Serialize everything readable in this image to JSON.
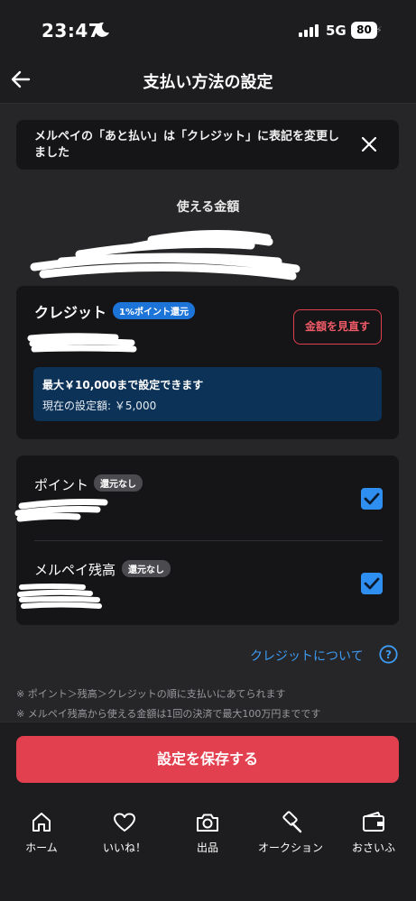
{
  "status": {
    "time": "23:47",
    "network": "5G",
    "battery": "80"
  },
  "header": {
    "title": "支払い方法の設定"
  },
  "notice": {
    "text": "メルペイの「あと払い」は「クレジット」に表記を変更しました"
  },
  "available": {
    "title": "使える金額"
  },
  "credit": {
    "label": "クレジット",
    "badge": "1%ポイント還元",
    "adjust_button": "金額を見直す",
    "limit_max": "最大￥10,000まで設定できます",
    "limit_current": "現在の設定額: ￥5,000"
  },
  "sources": [
    {
      "label": "ポイント",
      "badge": "還元なし",
      "checked": true
    },
    {
      "label": "メルペイ残高",
      "badge": "還元なし",
      "checked": true
    }
  ],
  "credit_about": "クレジットについて",
  "notes": [
    "※ ポイント＞残高＞クレジットの順に支払いにあてられます",
    "※ メルペイ残高から使える金額は1回の決済で最大100万円までです"
  ],
  "save_button": "設定を保存する",
  "nav": [
    {
      "label": "ホーム",
      "icon": "home-icon"
    },
    {
      "label": "いいね！",
      "icon": "heart-icon"
    },
    {
      "label": "出品",
      "icon": "camera-icon"
    },
    {
      "label": "オークション",
      "icon": "gavel-icon"
    },
    {
      "label": "おさいふ",
      "icon": "wallet-icon"
    }
  ],
  "colors": {
    "accent_red": "#e2404f",
    "link_blue": "#3d9bf2",
    "check_blue": "#2f8ff0",
    "badge_blue": "#1c74d8"
  }
}
